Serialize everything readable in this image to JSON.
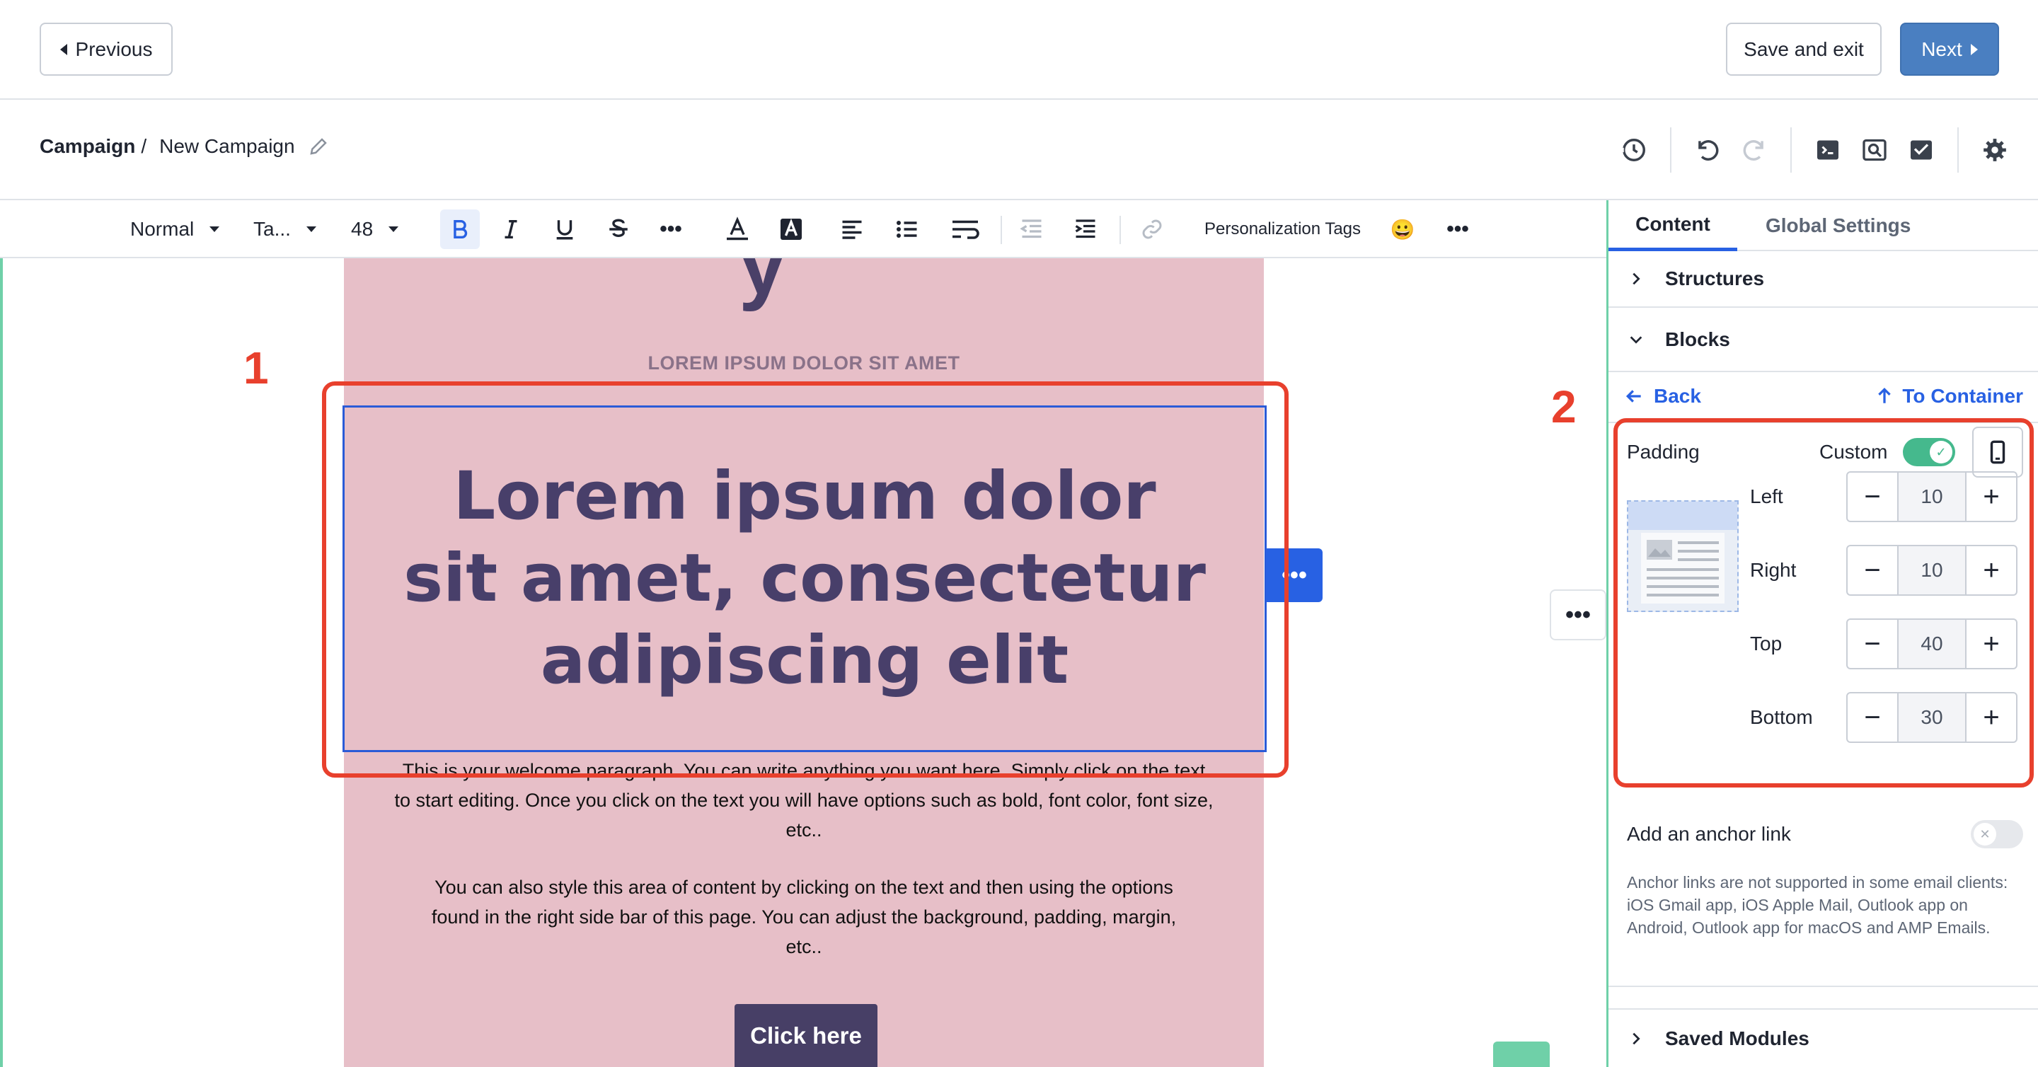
{
  "nav": {
    "previous_label": "Previous",
    "save_exit_label": "Save and exit",
    "next_label": "Next"
  },
  "breadcrumb": {
    "root": "Campaign",
    "separator": "/",
    "current": "New Campaign"
  },
  "toolbar": {
    "paragraph_style": "Normal",
    "font_family": "Ta...",
    "font_size": "48",
    "personalization_label": "Personalization Tags",
    "emoji": "😀",
    "more": "•••"
  },
  "email": {
    "eyebrow": "LOREM IPSUM DOLOR SIT AMET",
    "heading": "Lorem ipsum dolor sit amet, consectetur adipiscing elit",
    "paragraph1": "This is your welcome paragraph. You can write anything you want here. Simply click on the text to start editing. Once you click on the text you will have options such as bold, font color, font size, etc..",
    "paragraph2": "You can also style this area of content by clicking on the text and then using the options found in the right side bar of this page. You can adjust the background, padding, margin, etc..",
    "cta_label": "Click here",
    "partial_glyph": "y"
  },
  "annotations": {
    "label1": "1",
    "label2": "2",
    "color": "#e8402d"
  },
  "sidebar": {
    "tabs": [
      "Content",
      "Global Settings"
    ],
    "active_tab": "Content",
    "structures_label": "Structures",
    "blocks_label": "Blocks",
    "back_label": "Back",
    "to_container_label": "To Container",
    "padding_label": "Padding",
    "custom_label": "Custom",
    "custom_enabled": true,
    "padding": [
      {
        "label": "Left",
        "value": "10"
      },
      {
        "label": "Right",
        "value": "10"
      },
      {
        "label": "Top",
        "value": "40"
      },
      {
        "label": "Bottom",
        "value": "30"
      }
    ],
    "anchor_label": "Add an anchor link",
    "anchor_enabled": false,
    "anchor_note": "Anchor links are not supported in some email clients: iOS Gmail app, iOS Apple Mail, Outlook app on Android, Outlook app for macOS and AMP Emails.",
    "saved_modules_label": "Saved Modules"
  },
  "colors": {
    "accent_blue": "#2861e3",
    "next_button": "#4a7fc1",
    "toggle_green": "#45b98d",
    "email_bg": "#e7bfc8",
    "heading_color": "#483f6a",
    "cta_bg": "#473f66"
  },
  "icons": [
    "history-icon",
    "undo-icon",
    "redo-icon",
    "code-icon",
    "preview-icon",
    "test-email-icon",
    "settings-icon"
  ]
}
